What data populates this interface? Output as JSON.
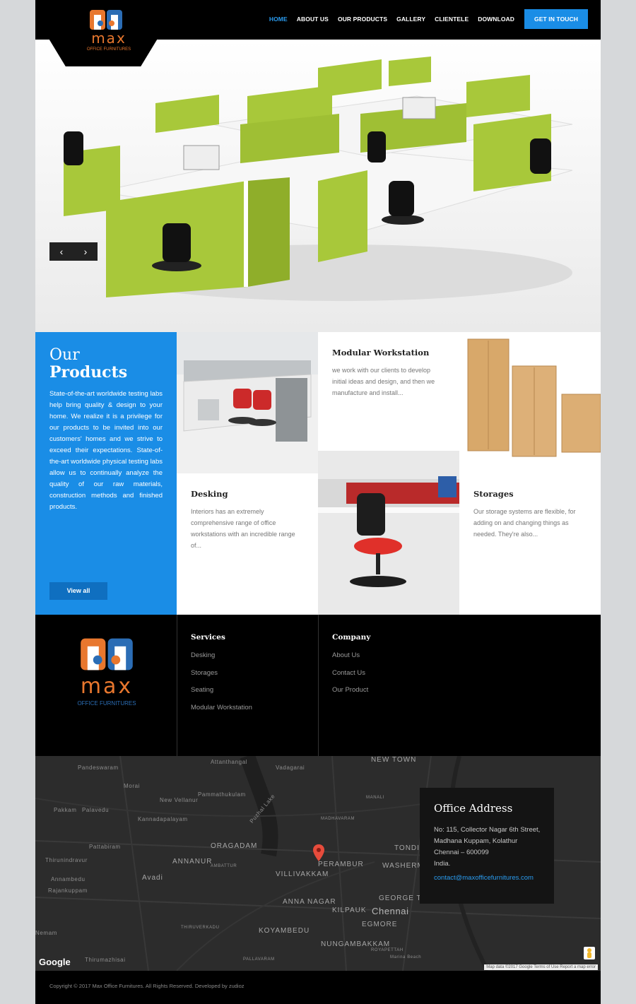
{
  "header": {
    "logo_word": "max",
    "logo_sub": "OFFICE FURNITURES",
    "nav": [
      "HOME",
      "ABOUT US",
      "OUR PRODUCTS",
      "GALLERY",
      "CLIENTELE",
      "DOWNLOAD"
    ],
    "cta": "GET IN TOUCH"
  },
  "hero": {
    "prev_icon": "chevron-left-icon",
    "next_icon": "chevron-right-icon",
    "prev": "‹",
    "next": "›"
  },
  "products": {
    "heading_line1": "Our",
    "heading_line2": "Products",
    "intro": "State-of-the-art worldwide testing labs help bring quality & design to your home. We realize it is a privilege for our products to be invited into our customers' homes and we strive to exceed their expectations. State-of-the-art worldwide physical testing labs allow us to continually analyze the quality of our raw materials, construction methods and finished products.",
    "view_all": "View all",
    "items": [
      {
        "title": "Modular Workstation",
        "desc": "we work with our clients to develop initial ideas and design, and then we manufacture and install..."
      },
      {
        "title": "Desking",
        "desc": "Interiors has an extremely comprehensive range of office workstations with an incredible range of..."
      },
      {
        "title": "Storages",
        "desc": "Our storage systems are flexible, for adding on and changing things as needed. They're also..."
      }
    ]
  },
  "footer": {
    "logo_word": "max",
    "logo_sub": "OFFICE FURNITURES",
    "services_title": "Services",
    "services": [
      "Desking",
      "Storages",
      "Seating",
      "Modular Workstation"
    ],
    "company_title": "Company",
    "company": [
      "About Us",
      "Contact Us",
      "Our Product"
    ]
  },
  "map": {
    "labels": [
      "Pandeswaram",
      "Attanthangal",
      "Vadagarai",
      "NEW TOWN",
      "Morai",
      "Pammathukulam",
      "New Vellanur",
      "Pakkam",
      "Palavedu",
      "Kannadapalayam",
      "Puzhal Lake",
      "MADHAVARAM",
      "MANALI",
      "Pattabiram",
      "ORAGADAM",
      "ANNANUR",
      "AMBATTUR",
      "Thirunindravur",
      "Annambedu",
      "Avadi",
      "Rajankuppam",
      "PERAMBUR",
      "VILLIVAKKAM",
      "TONDIARPET",
      "WASHERMANPET",
      "GEORGE TOWN",
      "Chennai",
      "ANNA NAGAR",
      "KILPAUK",
      "EGMORE",
      "KOYAMBEDU",
      "THIRUVERKADU",
      "NUNGAMBAKKAM",
      "Thirumazhisai",
      "Nemam",
      "PALLAVARAM",
      "ROYAPETTAH",
      "Marina Beach"
    ],
    "address_title": "Office Address",
    "address": [
      "No: 115, Collector Nagar 6th Street,",
      "Madhana Kuppam, Kolathur",
      "Chennai – 600099",
      "India."
    ],
    "email": "contact@maxofficefurnitures.com",
    "google": "Google",
    "attribution": "Map data ©2017 Google   Terms of Use   Report a map error"
  },
  "copyright": "Copyright © 2017 Max Office Furnitures. All Rights Reserved. Developed by zudioz",
  "colors": {
    "accent": "#1a8de6",
    "brand_orange": "#e8772e",
    "panel_green": "#a8c83a"
  }
}
